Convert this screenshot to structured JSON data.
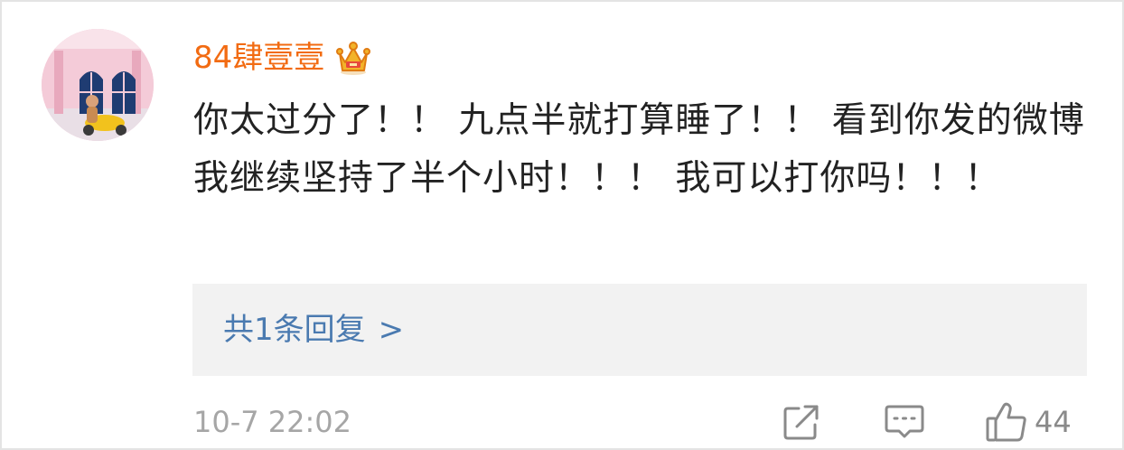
{
  "comment": {
    "username": "84肆壹壹",
    "badge_icon": "crown-icon",
    "text": "你太过分了！！ 九点半就打算睡了！！ 看到你发的微博 我继续坚持了半个小时！！！ 我可以打你吗！！！",
    "replies_link": "共1条回复",
    "replies_chevron": ">",
    "timestamp": "10-7 22:02",
    "like_count": "44"
  },
  "colors": {
    "username": "#f26b12",
    "text": "#222222",
    "link": "#4a7ab0",
    "meta": "#a6a6a6",
    "reply_bg": "#f2f2f2",
    "icon": "#8a8a8a"
  },
  "icons": {
    "share": "share-icon",
    "comment": "comment-icon",
    "like": "thumbs-up-icon"
  }
}
